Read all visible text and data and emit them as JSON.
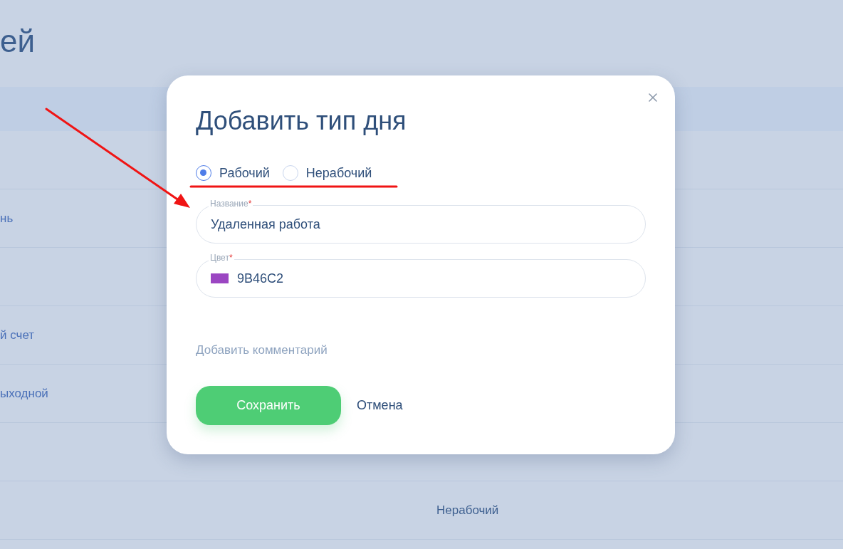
{
  "page": {
    "title": "ей",
    "table": {
      "rows": [
        {},
        {
          "column_1": "нь"
        },
        {},
        {
          "column_1": "й счет"
        },
        {
          "column_1": "ыходной"
        },
        {},
        {
          "column_2": "Нерабочий"
        }
      ]
    }
  },
  "dialog": {
    "title": "Добавить тип дня",
    "day_kinds": [
      {
        "label": "Рабочий",
        "selected": true
      },
      {
        "label": "Нерабочий",
        "selected": false
      }
    ],
    "fields": [
      {
        "kind": "text",
        "label": "Название",
        "required_mark": "*",
        "value": "Удаленная работа"
      },
      {
        "kind": "color",
        "label": "Цвет",
        "required_mark": "*",
        "value": "9B46C2",
        "color": "#9b46c2"
      }
    ],
    "comment_link": "Добавить комментарий",
    "buttons": [
      {
        "kind": "primary",
        "label": "Сохранить"
      },
      {
        "kind": "secondary",
        "label": "Отмена"
      }
    ]
  },
  "annotations": {
    "arrow": true,
    "underline": true
  }
}
